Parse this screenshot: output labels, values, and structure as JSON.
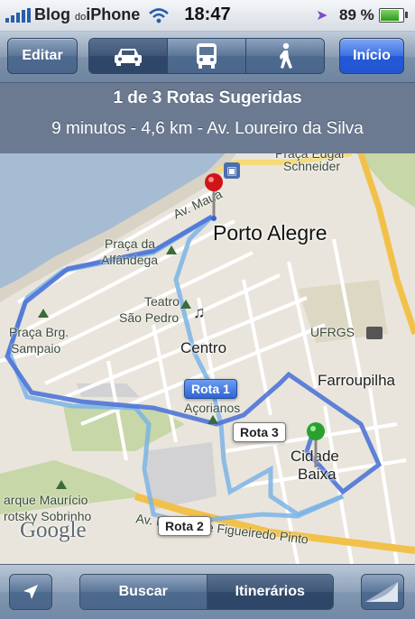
{
  "status_bar": {
    "carrier": "Blog",
    "carrier_small": "do",
    "carrier_suffix": "iPhone",
    "time": "18:47",
    "battery_percent": "89 %",
    "battery_level": 0.89
  },
  "nav": {
    "edit_label": "Editar",
    "home_label": "Início",
    "modes": [
      {
        "name": "car-icon",
        "selected": true
      },
      {
        "name": "bus-icon",
        "selected": false
      },
      {
        "name": "walk-icon",
        "selected": false
      }
    ]
  },
  "route_info": {
    "title": "1 de 3 Rotas Sugeridas",
    "summary": "9 minutos - 4,6 km - Av. Loureiro da Silva"
  },
  "map": {
    "city": "Porto Alegre",
    "labels": {
      "av_maua": "Av. Mauá",
      "praca_da": "Praça da",
      "alfandega": "Alfândega",
      "teatro": "Teatro",
      "sao_pedro": "São Pedro",
      "centro": "Centro",
      "praca_brg": "Praça Brg.",
      "sampaio": "Sampaio",
      "praca_edgar": "Praça Edgar",
      "schneider": "Schneider",
      "ufrgs": "UFRGS",
      "farroupilha": "Farroupilha",
      "acorianos": "Açorianos",
      "cidade": "Cidade",
      "baixa": "Baixa",
      "parque_mauricio": "arque Maurício",
      "sobrinho": "rotsky Sobrinho",
      "av_figueiredo": "Av. Borges de Figueiredo Pinto"
    },
    "routes": [
      "Rota 1",
      "Rota 2",
      "Rota 3"
    ],
    "attribution": "Google"
  },
  "toolbar": {
    "search_label": "Buscar",
    "directions_label": "Itinerários"
  },
  "colors": {
    "route_active": "#4f74d6",
    "route_alt": "#7bb4e6",
    "pin_start": "#d0141a",
    "pin_end": "#2aa12f"
  }
}
